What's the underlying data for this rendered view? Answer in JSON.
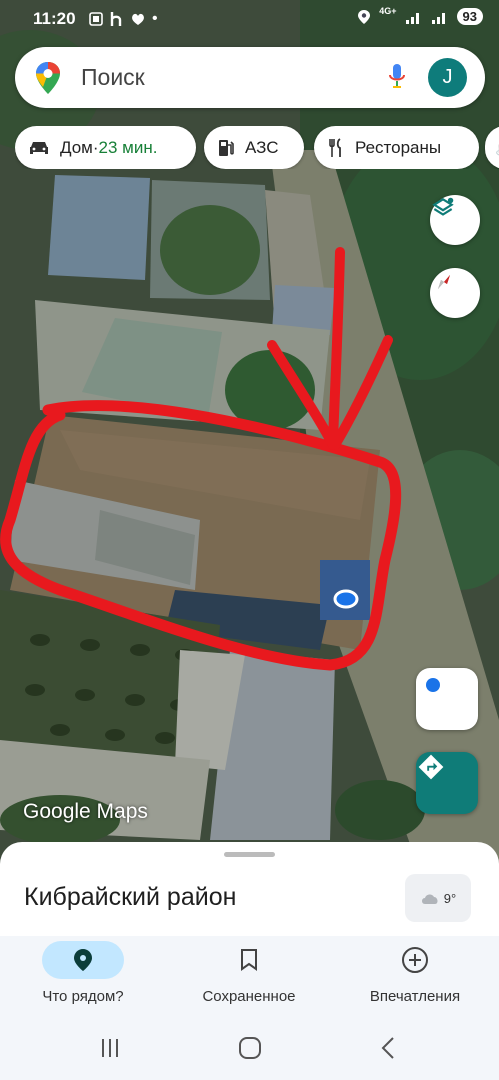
{
  "status_bar": {
    "time": "11:20",
    "network": "4G+",
    "battery": "93"
  },
  "search": {
    "placeholder": "Поиск",
    "avatar_letter": "J"
  },
  "chips": [
    {
      "icon": "car-icon",
      "label": "Дом",
      "separator": " · ",
      "eta": "23 мин."
    },
    {
      "icon": "gas-station-icon",
      "label": "АЗС"
    },
    {
      "icon": "restaurant-icon",
      "label": "Рестораны"
    }
  ],
  "map": {
    "attribution": "Google Maps",
    "annotation_color": "#e8191e",
    "location_dot_color": "#1a73e8"
  },
  "bottom_sheet": {
    "place_name": "Кибрайский район",
    "weather_temp": "9°"
  },
  "bottom_nav": {
    "items": [
      {
        "label": "Что рядом?",
        "icon": "location-pin-icon",
        "active": true
      },
      {
        "label": "Сохраненное",
        "icon": "bookmark-icon",
        "active": false
      },
      {
        "label": "Впечатления",
        "icon": "add-circle-icon",
        "active": false
      }
    ]
  },
  "colors": {
    "accent": "#0f7c78",
    "active_tab_bg": "#c2e7ff"
  }
}
